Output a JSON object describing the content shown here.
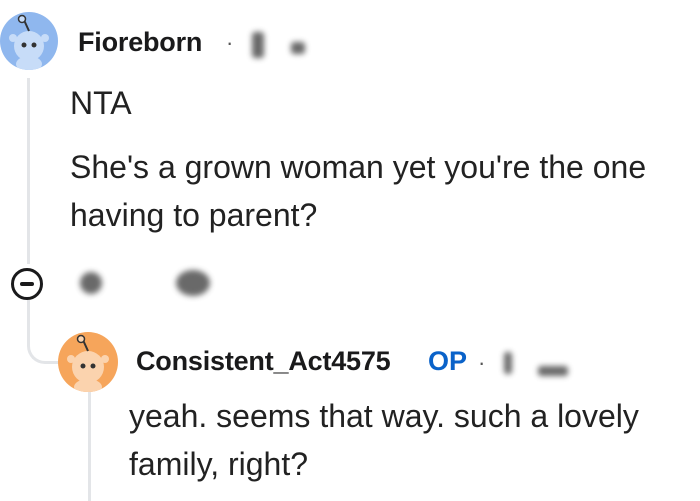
{
  "comments": [
    {
      "username": "Fioreborn",
      "separator": "·",
      "paragraphs": [
        "NTA",
        "She's a grown woman yet you're the one having to parent?"
      ],
      "avatar_icon": "reddit-snoo-avatar-icon"
    },
    {
      "username": "Consistent_Act4575",
      "badge": "OP",
      "separator": "·",
      "paragraphs": [
        "yeah. seems that way. such a lovely family, right?"
      ],
      "avatar_icon": "reddit-snoo-avatar-icon"
    }
  ],
  "colors": {
    "op_badge": "#0a62c9",
    "avatar_blue": "#8fb7ee",
    "avatar_orange": "#f6a55b",
    "thread_line": "#e3e5e8"
  }
}
